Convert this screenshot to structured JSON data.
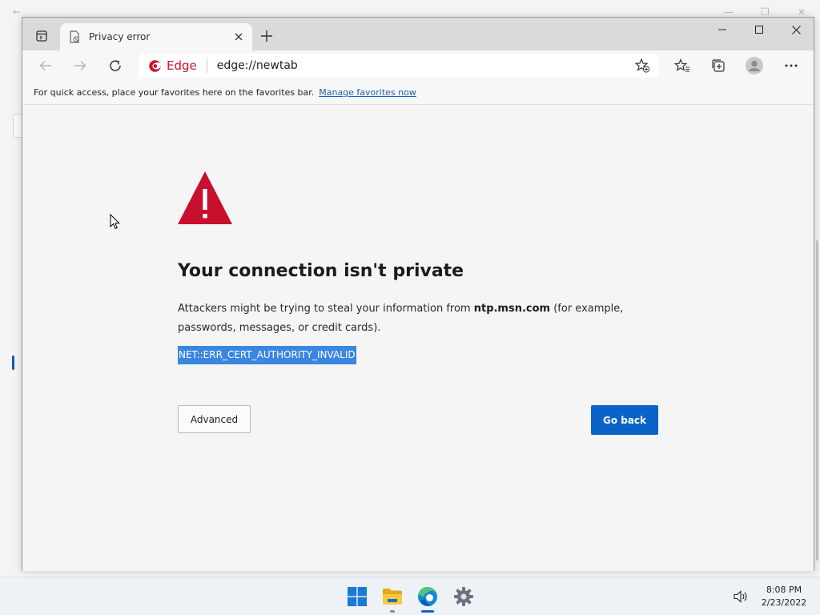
{
  "browser": {
    "tab": {
      "title": "Privacy error"
    },
    "address": {
      "engine_label": "Edge",
      "url": "edge://newtab"
    },
    "favorites_bar": {
      "message": "For quick access, place your favorites here on the favorites bar.",
      "link": "Manage favorites now"
    }
  },
  "error_page": {
    "heading": "Your connection isn't private",
    "description_prefix": "Attackers might be trying to steal your information from ",
    "host": "ntp.msn.com",
    "description_suffix": " (for example, passwords, messages, or credit cards).",
    "error_code": "NET::ERR_CERT_AUTHORITY_INVALID",
    "advanced_label": "Advanced",
    "go_back_label": "Go back"
  },
  "taskbar": {
    "apps": [
      {
        "name": "Start",
        "icon": "windows-start-icon"
      },
      {
        "name": "File Explorer",
        "icon": "folder-icon"
      },
      {
        "name": "Microsoft Edge",
        "icon": "edge-icon"
      },
      {
        "name": "Settings",
        "icon": "gear-icon"
      }
    ],
    "time": "8:08 PM",
    "date": "2/23/2022"
  },
  "colors": {
    "accent": "#0a64c8",
    "warning": "#c8102e",
    "selection": "#3b86e0",
    "edge_brand": "#c4152a"
  }
}
